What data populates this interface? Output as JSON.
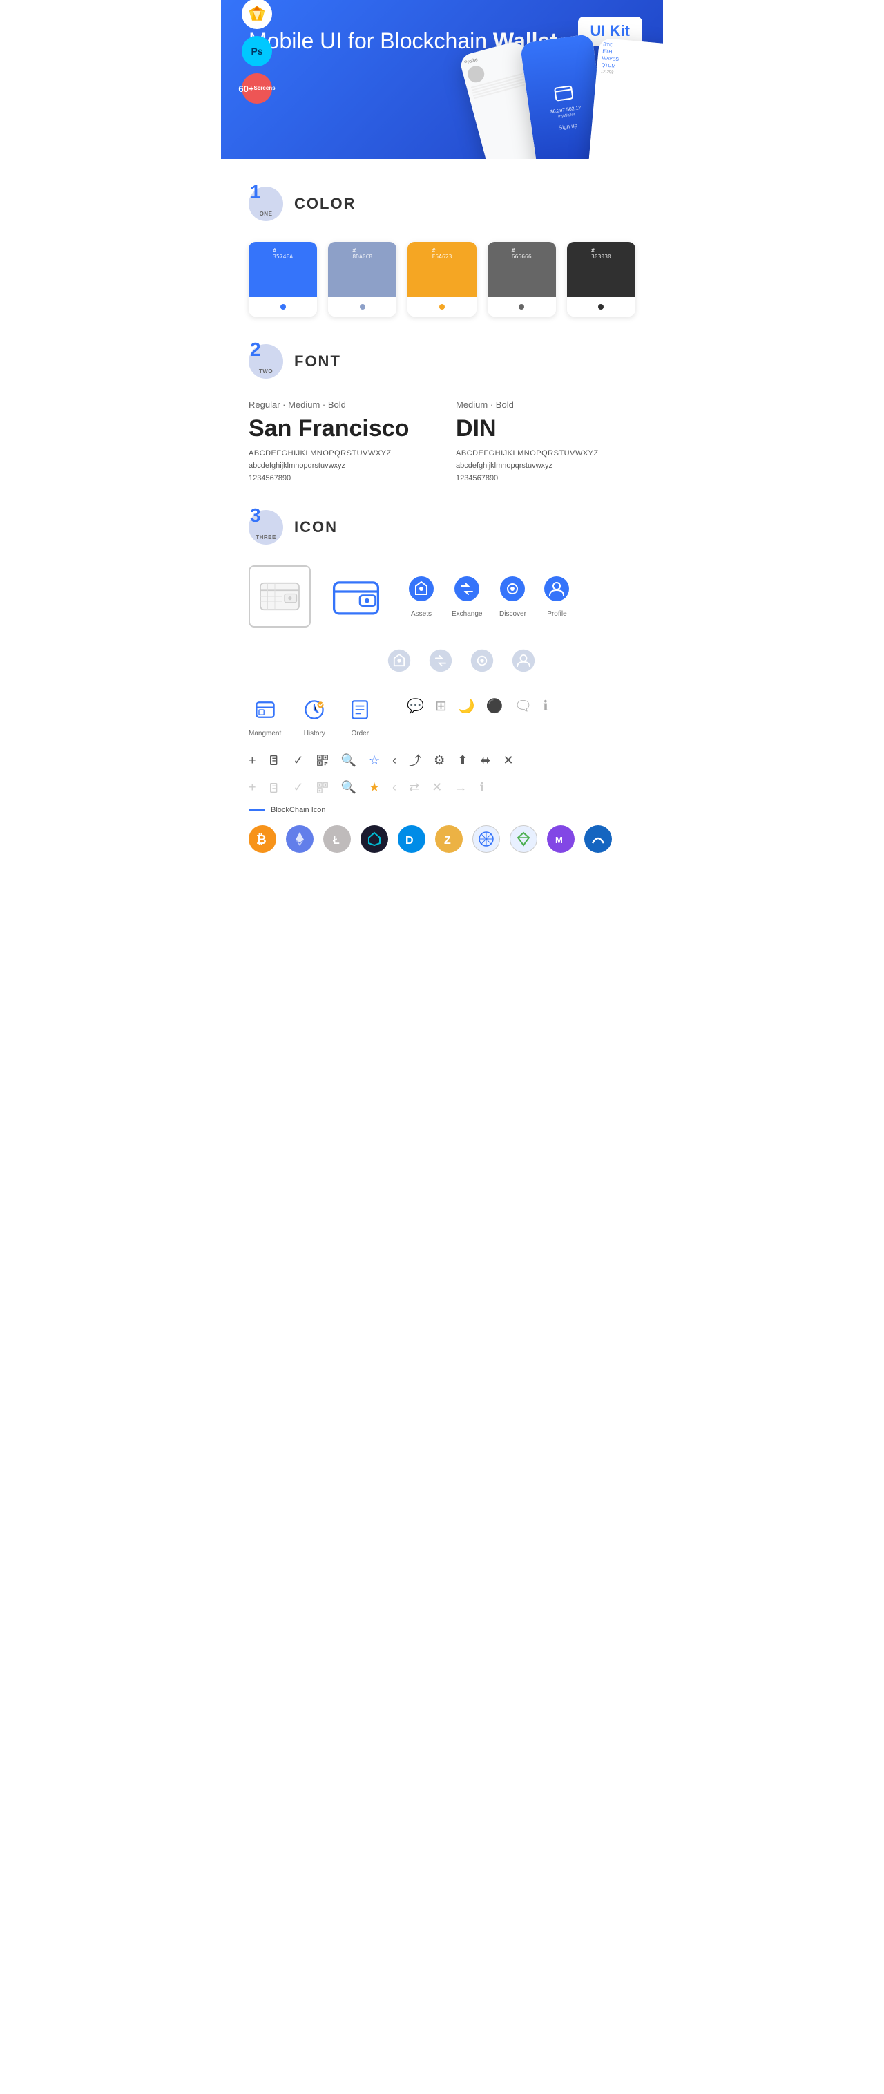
{
  "hero": {
    "title": "Mobile UI for Blockchain ",
    "title_bold": "Wallet",
    "badge": "UI Kit",
    "badge_sketch": "Sketch",
    "badge_ps": "Ps",
    "badge_screens": "60+\nScreens"
  },
  "sections": {
    "color": {
      "number": "1",
      "label": "ONE",
      "title": "COLOR",
      "swatches": [
        {
          "hex": "#3574FA",
          "code": "#\n3574FA"
        },
        {
          "hex": "#8D A0C8",
          "code": "#\n8DA0C8"
        },
        {
          "hex": "#F5A623",
          "code": "#\nF5A623"
        },
        {
          "hex": "#666666",
          "code": "#\n666666"
        },
        {
          "hex": "#303030",
          "code": "#\n303030"
        }
      ]
    },
    "font": {
      "number": "2",
      "label": "TWO",
      "title": "FONT",
      "fonts": [
        {
          "variants": "Regular · Medium · Bold",
          "name": "San Francisco",
          "uppercase": "ABCDEFGHIJKLMNOPQRSTUVWXYZ",
          "lowercase": "abcdefghijklmnopqrstuvwxyz",
          "numbers": "1234567890"
        },
        {
          "variants": "Medium · Bold",
          "name": "DIN",
          "uppercase": "ABCDEFGHIJKLMNOPQRSTUVWXYZ",
          "lowercase": "abcdefghijklmnopqrstuvwxyz",
          "numbers": "1234567890"
        }
      ]
    },
    "icon": {
      "number": "3",
      "label": "THREE",
      "title": "ICON",
      "nav_icons": [
        {
          "label": "Assets"
        },
        {
          "label": "Exchange"
        },
        {
          "label": "Discover"
        },
        {
          "label": "Profile"
        }
      ],
      "mgmt_icons": [
        {
          "label": "Mangment"
        },
        {
          "label": "History"
        },
        {
          "label": "Order"
        }
      ],
      "blockchain_label": "BlockChain Icon"
    }
  }
}
